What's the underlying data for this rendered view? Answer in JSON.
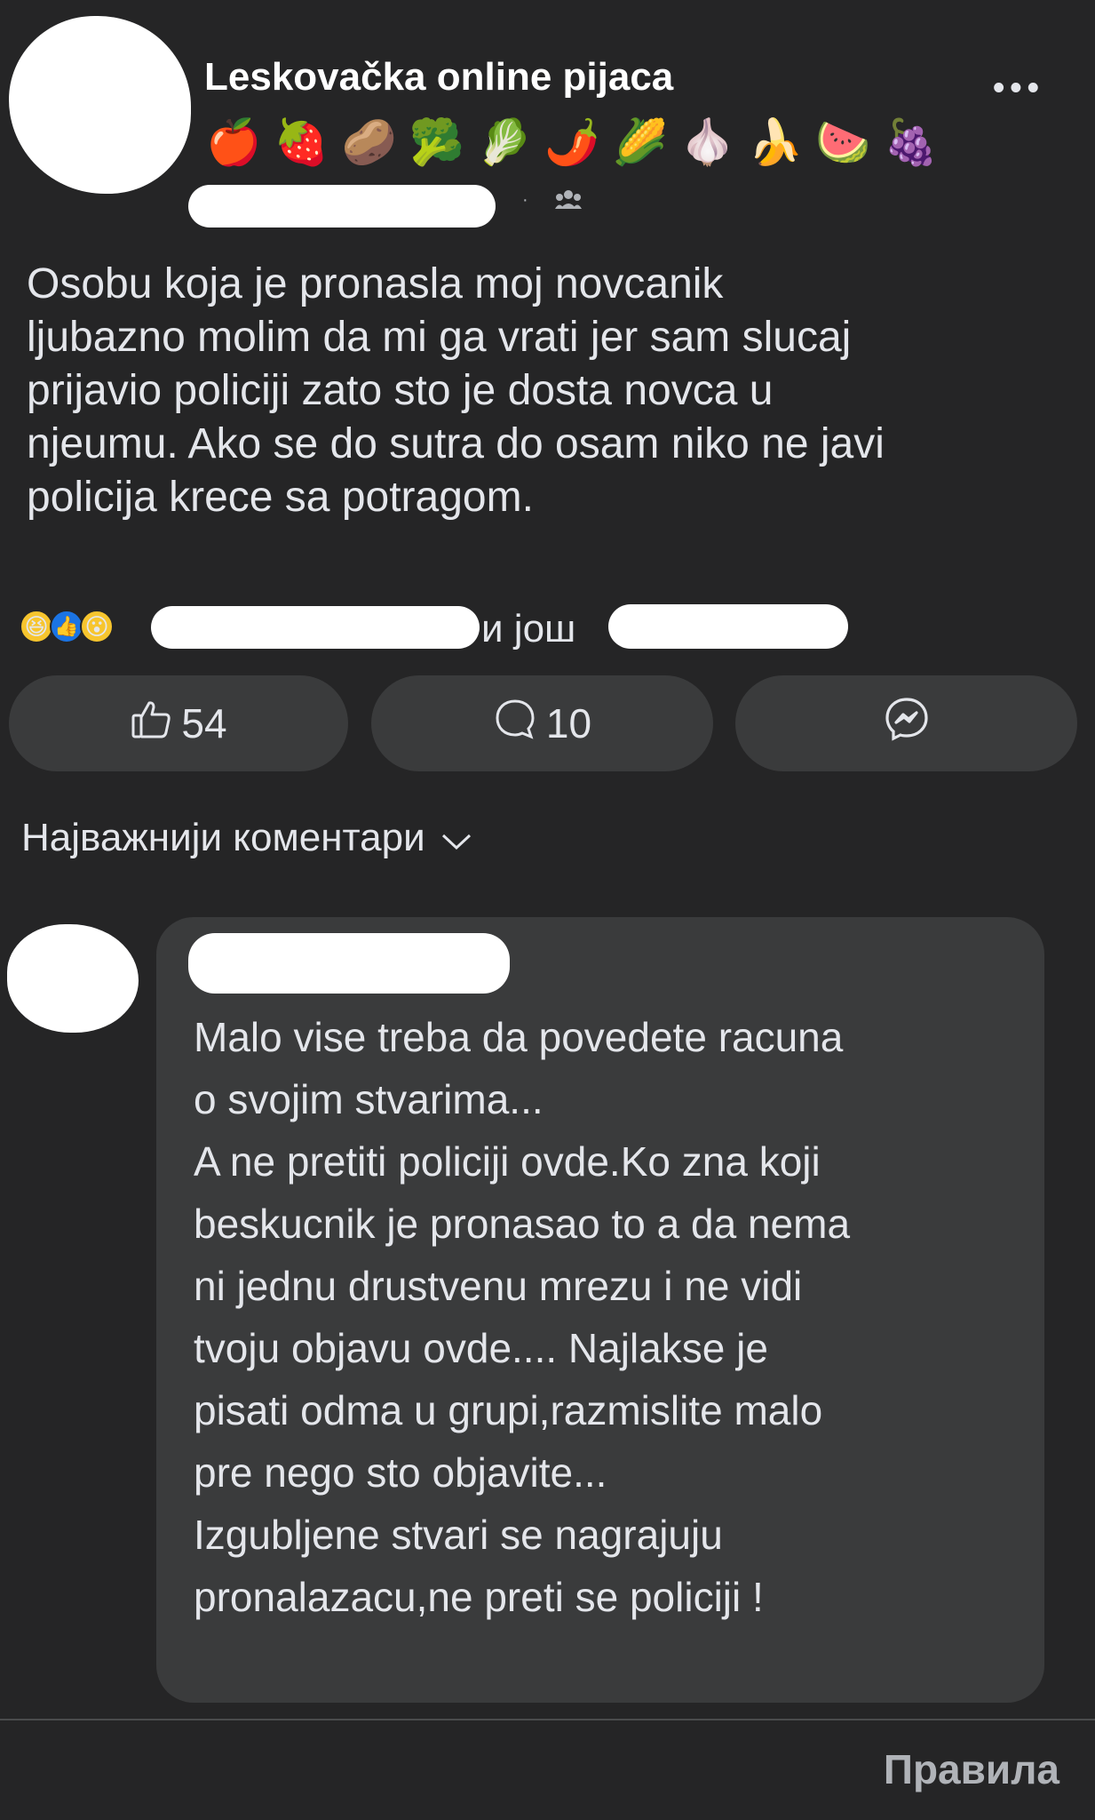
{
  "post": {
    "group_name": "Leskovačka online pijaca",
    "group_emojis": [
      "🍎",
      "🍓",
      "🥔",
      "🥦",
      "🥬",
      "🌶️",
      "🌽",
      "🧄",
      "🍌",
      "🍉",
      "🍇"
    ],
    "more_label": "•••",
    "meta_separator": "·",
    "text": "Osobu koja je pronasla moj novcanik\nljubazno molim da mi ga vrati jer sam slucaj\nprijavio policiji zato sto je dosta novca u\nnjeumu. Ako se do sutra do osam niko ne javi\npolicija krece sa potragom."
  },
  "reactions": {
    "icons": [
      "😆",
      "👍",
      "😮"
    ],
    "and_more_label": "и још"
  },
  "actions": {
    "like_count": "54",
    "comment_count": "10"
  },
  "comments": {
    "sort_label": "Најважнији коментари",
    "first": {
      "text": "Malo vise treba da povedete racuna\no svojim stvarima...\nA ne pretiti policiji ovde.Ko zna koji\nbeskucnik je pronasao to a da nema\nni jednu drustvenu mrezu i ne vidi\ntvoju objavu ovde.... Najlakse je\npisati odma u grupi,razmislite malo\npre nego sto objavite...\nIzgubljene stvari se nagrajuju\npronalazacu,ne preti se policiji !"
    }
  },
  "footer": {
    "rules_label": "Правила"
  },
  "colors": {
    "background": "#252526",
    "surface": "#3a3b3c",
    "text": "#e4e6eb",
    "muted": "#b0b3b8",
    "like_blue": "#1b74e4"
  }
}
